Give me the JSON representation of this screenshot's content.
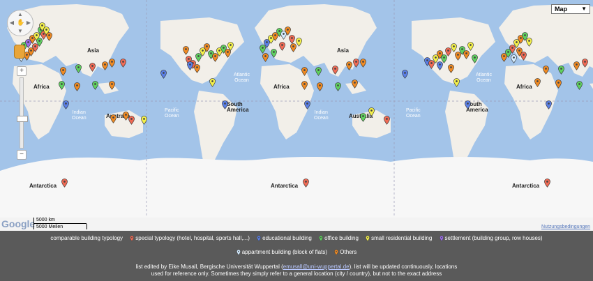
{
  "map": {
    "type_control": "Map",
    "ocean_labels": [
      {
        "text": "Indian\nOcean"
      },
      {
        "text": "Pacific\nOcean"
      },
      {
        "text": "Atlantic\nOcean"
      },
      {
        "text": "Indian\nOcean"
      },
      {
        "text": "Pacific\nOcean"
      },
      {
        "text": "Atlantic\nOcean"
      }
    ],
    "land_labels": {
      "asia_1": "Asia",
      "asia_2": "Asia",
      "africa_1": "Africa",
      "africa_2": "Africa",
      "africa_3": "Africa",
      "australia_1": "Australia",
      "australia_2": "Australia",
      "south_america_1": "South\nAmerica",
      "south_america_2": "South\nAmerica",
      "antarctica_1": "Antarctica",
      "antarctica_2": "Antarctica",
      "antarctica_3": "Antarctica"
    },
    "google_logo": "Google",
    "scale_km": "5000 km",
    "scale_mi": "5000 Meilen",
    "terms": "Nutzungsbedingungen",
    "pin_colors": {
      "special": "#f06a54",
      "educational": "#5a7fe6",
      "office": "#5fd05f",
      "small_residential": "#f4f04a",
      "settlement": "#9a6ce8",
      "appartment": "#d4ecff",
      "others": "#f08a22"
    }
  },
  "legend": {
    "intro": "comparable building typology",
    "items": [
      {
        "label": "special typology (hotel, hospital, sports hall,...)",
        "color": "#f06a54"
      },
      {
        "label": "educational building",
        "color": "#5a7fe6"
      },
      {
        "label": "office building",
        "color": "#5fd05f"
      },
      {
        "label": "small residential building",
        "color": "#f4f04a"
      },
      {
        "label": "settlement (building group, row houses)",
        "color": "#9a6ce8"
      },
      {
        "label": "appartment building (block of flats)",
        "color": "#d4ecff"
      },
      {
        "label": "Others",
        "color": "#f08a22"
      }
    ]
  },
  "credit": {
    "line1_pre": "list edited by Eike Musall, Bergische Universität Wuppertal (",
    "email": "emusall@uni-wuppertal.de",
    "line1_post": "). list will be updated continuously, locations",
    "line2": "used for reference only. Sometimes they simply refer to a general location (city / country), but not to the exact address"
  }
}
